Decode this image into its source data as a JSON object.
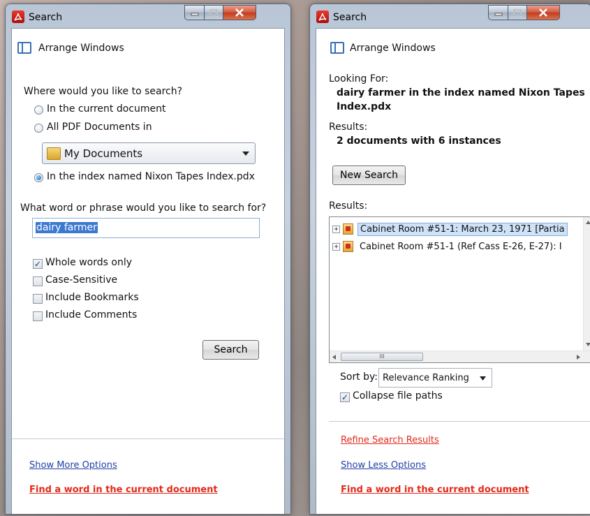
{
  "left_window": {
    "title": "Search",
    "arrange_windows": "Arrange Windows",
    "where_prompt": "Where would you like to search?",
    "options": [
      {
        "label": "In the current document",
        "selected": false
      },
      {
        "label": "All PDF Documents in",
        "selected": false
      },
      {
        "label": "In the index named Nixon Tapes Index.pdx",
        "selected": true
      }
    ],
    "folder_dropdown": "My Documents",
    "phrase_prompt": "What word or phrase would you like to search for?",
    "search_value": "dairy farmer",
    "checkboxes": [
      {
        "label": "Whole words only",
        "checked": true
      },
      {
        "label": "Case-Sensitive",
        "checked": false
      },
      {
        "label": "Include Bookmarks",
        "checked": false
      },
      {
        "label": "Include Comments",
        "checked": false
      }
    ],
    "search_button": "Search",
    "show_more_options": "Show More Options",
    "find_word_link": "Find a word in the current document"
  },
  "right_window": {
    "title": "Search",
    "arrange_windows": "Arrange Windows",
    "looking_for_label": "Looking For:",
    "looking_for_value_line1": "dairy farmer in the index named Nixon Tapes",
    "looking_for_value_line2": "Index.pdx",
    "results_label": "Results:",
    "results_summary": "2 documents with 6 instances",
    "new_search_button": "New Search",
    "results_list_label": "Results:",
    "results": [
      {
        "label": "Cabinet Room #51-1: March 23, 1971 [Partia",
        "selected": true
      },
      {
        "label": "Cabinet Room #51-1 (Ref Cass E-26, E-27): I",
        "selected": false
      }
    ],
    "scroll_thumb_glyph": "III",
    "sort_by_label": "Sort by:",
    "sort_by_value": "Relevance Ranking",
    "collapse_file_paths": {
      "label": "Collapse file paths",
      "checked": true
    },
    "refine_link": "Refine Search Results",
    "show_less_options": "Show Less Options",
    "find_word_link": "Find a word in the current document"
  },
  "colors": {
    "link_blue": "#1e3fa6",
    "link_red": "#e22a1a",
    "selection": "#3b78d0"
  }
}
